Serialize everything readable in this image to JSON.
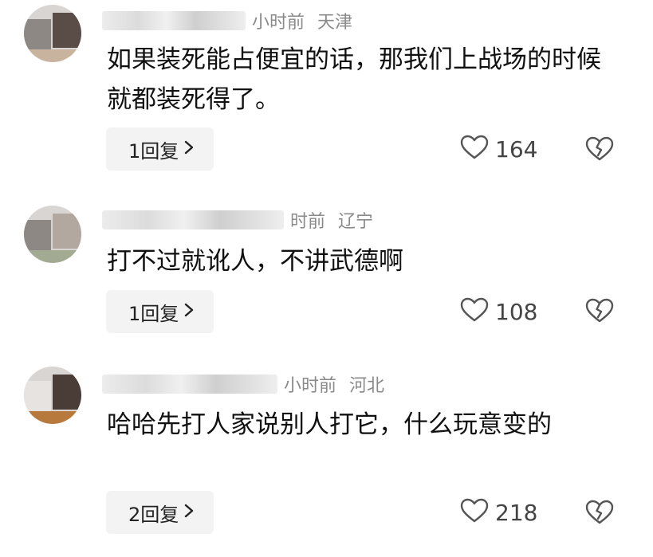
{
  "comments": [
    {
      "time": "小时前",
      "region": "天津",
      "text": "如果装死能占便宜的话，那我们上战场的时候就都装死得了。",
      "reply_label": "1回复",
      "likes": "164"
    },
    {
      "time": "时前",
      "region": "辽宁",
      "text": "打不过就讹人，不讲武德啊",
      "reply_label": "1回复",
      "likes": "108"
    },
    {
      "time": "小时前",
      "region": "河北",
      "text": "哈哈先打人家说别人打它，什么玩意变的",
      "reply_label": "2回复",
      "likes": "218"
    }
  ],
  "icons": {
    "like": "heart-outline-icon",
    "dislike": "broken-heart-icon",
    "reply_chevron": "chevron-right-icon"
  },
  "colors": {
    "meta_text": "#8a8a8a",
    "reply_bg": "#f3f3f3",
    "icon_stroke": "#555555"
  }
}
